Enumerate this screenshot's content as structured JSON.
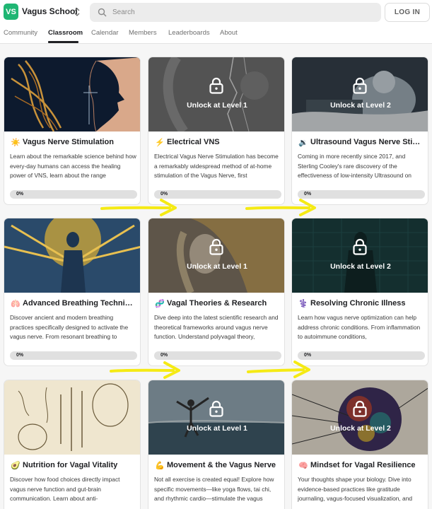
{
  "header": {
    "logo_text": "VS",
    "brand_name": "Vagus School",
    "search_placeholder": "Search",
    "login_label": "LOG IN"
  },
  "nav": {
    "tabs": [
      "Community",
      "Classroom",
      "Calendar",
      "Members",
      "Leaderboards",
      "About"
    ],
    "active": "Classroom"
  },
  "colors": {
    "accent": "#1fb673",
    "annotation_arrow": "#f5ea14"
  },
  "courses": [
    {
      "icon": "sun-icon",
      "glyph": "☀️",
      "title": "Vagus Nerve Stimulation",
      "description": "Learn about the remarkable science behind how every-day humans can access the healing power of VNS, learn about the range",
      "progress": "0%",
      "locked": false,
      "lock_label": ""
    },
    {
      "icon": "lightning-icon",
      "glyph": "⚡",
      "title": "Electrical VNS",
      "description": "Electrical Vagus Nerve Stimulation has become a remarkably widespread method of at-home stimulation of the Vagus Nerve, first",
      "progress": "0%",
      "locked": true,
      "lock_label": "Unlock at Level 1"
    },
    {
      "icon": "speaker-icon",
      "glyph": "🔉",
      "title": "Ultrasound Vagus Nerve Stim...",
      "description": "Coming in more recently since 2017, and Sterling Cooley's rare discovery of the effectiveness of low-intensity Ultrasound on",
      "progress": "0%",
      "locked": true,
      "lock_label": "Unlock at Level 2"
    },
    {
      "icon": "lungs-icon",
      "glyph": "🫁",
      "title": "Advanced Breathing Techniqu...",
      "description": "Discover ancient and modern breathing practices specifically designed to activate the vagus nerve. From resonant breathing to",
      "progress": "0%",
      "locked": false,
      "lock_label": ""
    },
    {
      "icon": "dna-icon",
      "glyph": "🧬",
      "title": "Vagal Theories & Research",
      "description": "Dive deep into the latest scientific research and theoretical frameworks around vagus nerve function. Understand polyvagal theory,",
      "progress": "0%",
      "locked": true,
      "lock_label": "Unlock at Level 1"
    },
    {
      "icon": "caduceus-icon",
      "glyph": "⚕️",
      "title": "Resolving Chronic Illness",
      "description": "Learn how vagus nerve optimization can help address chronic conditions. From inflammation to autoimmune conditions,",
      "progress": "0%",
      "locked": true,
      "lock_label": "Unlock at Level 2"
    },
    {
      "icon": "avocado-icon",
      "glyph": "🥑",
      "title": "Nutrition for Vagal Vitality",
      "description": "Discover how food choices directly impact vagus nerve function and gut-brain communication. Learn about anti-",
      "progress": "0%",
      "locked": false,
      "lock_label": ""
    },
    {
      "icon": "flexed-arm-icon",
      "glyph": "💪",
      "title": "Movement & the Vagus Nerve",
      "description": "Not all exercise is created equal! Explore how specific movements—like yoga flows, tai chi, and rhythmic cardio—stimulate the vagus",
      "progress": "0%",
      "locked": true,
      "lock_label": "Unlock at Level 1"
    },
    {
      "icon": "brain-icon",
      "glyph": "🧠",
      "title": "Mindset for Vagal Resilience",
      "description": "Your thoughts shape your biology. Dive into evidence-based practices like gratitude journaling, vagus-focused visualization, and",
      "progress": "0%",
      "locked": true,
      "lock_label": "Unlock at Level 2"
    }
  ]
}
